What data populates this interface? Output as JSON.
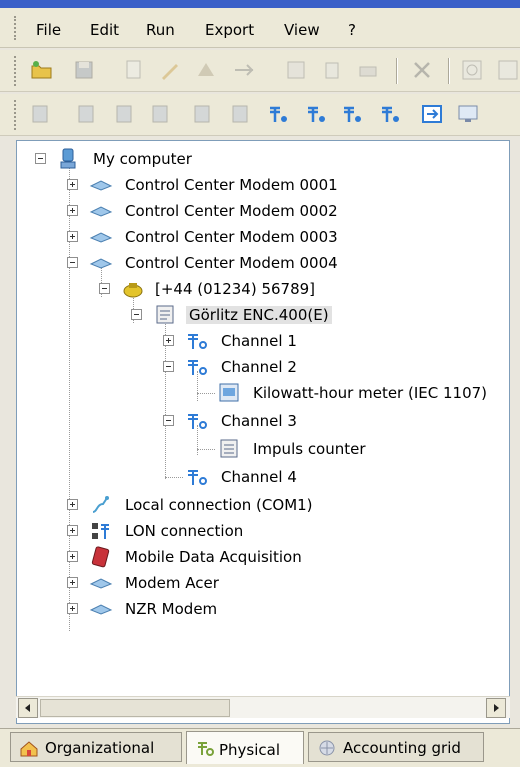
{
  "menu": [
    "File",
    "Edit",
    "Run",
    "Export",
    "View",
    "?"
  ],
  "toolbar1": {
    "icons": [
      "open-folder-icon",
      "disk-icon",
      "new-doc-icon",
      "edit-icon",
      "device-icon",
      "connect-icon",
      "list-icon",
      "pages-icon",
      "print-icon",
      "tools-icon",
      "zoom-icon",
      "zoom2-icon"
    ]
  },
  "toolbar2": {
    "icons": [
      "readout-1-icon",
      "readout-2-icon",
      "readout-3-icon",
      "readout-4-icon",
      "readout-5-icon",
      "readout-6-icon",
      "channel-7-icon",
      "channel-8-icon",
      "channel-9-icon",
      "channel-10-icon",
      "export-icon",
      "monitor-icon"
    ]
  },
  "tree": {
    "root": "My computer",
    "modems": [
      "Control Center Modem 0001",
      "Control Center Modem 0002",
      "Control Center Modem 0003",
      "Control Center Modem 0004"
    ],
    "phone": "[+44 (01234) 56789]",
    "device": "Görlitz ENC.400(E)",
    "channel1": "Channel 1",
    "channel2": "Channel 2",
    "meter": "Kilowatt-hour meter (IEC 1107)",
    "channel3": "Channel 3",
    "counter": "Impuls counter",
    "channel4": "Channel 4",
    "local": "Local connection (COM1)",
    "lon": "LON connection",
    "mobile": "Mobile Data Acquisition",
    "acer": "Modem Acer",
    "nzr": "NZR Modem"
  },
  "tabs": [
    "Organizational",
    "Physical",
    "Accounting grid"
  ],
  "active_tab": "Physical",
  "colors": {
    "selection": "#e2e2e2",
    "tree_border": "#7f9db9",
    "window_bg": "#ece9d8"
  }
}
